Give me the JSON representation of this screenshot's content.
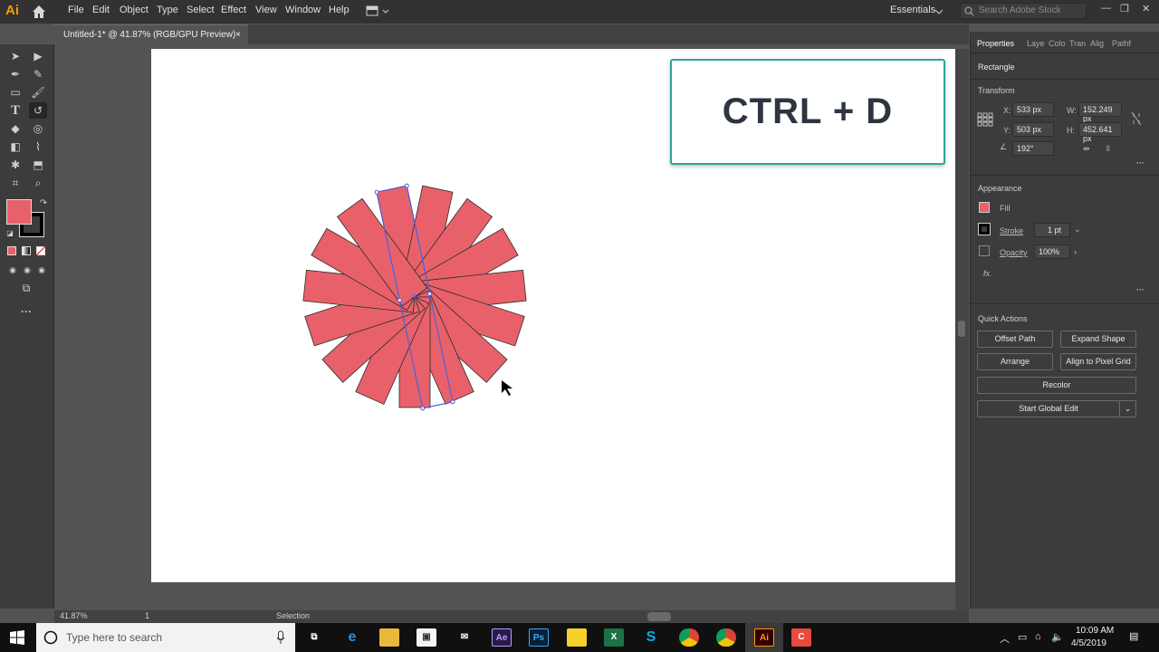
{
  "app": {
    "logo": "Ai",
    "workspace": "Essentials",
    "search_placeholder": "Search Adobe Stock"
  },
  "menu": [
    "File",
    "Edit",
    "Object",
    "Type",
    "Select",
    "Effect",
    "View",
    "Window",
    "Help"
  ],
  "document": {
    "tab_title": "Untitled-1* @ 41.87% (RGB/GPU Preview)",
    "close": "×"
  },
  "overlay": {
    "text": "CTRL + D"
  },
  "status": {
    "zoom": "41.87%",
    "page": "1",
    "tool": "Selection"
  },
  "properties": {
    "tabs": [
      "Properties",
      "Laye",
      "Colo",
      "Tran",
      "Alig",
      "Pathf"
    ],
    "object_type": "Rectangle",
    "transform": {
      "title": "Transform",
      "x_label": "X:",
      "x": "533 px",
      "y_label": "Y:",
      "y": "503 px",
      "w_label": "W:",
      "w": "152.249 px",
      "h_label": "H:",
      "h": "452.641 px",
      "angle": "192°"
    },
    "appearance": {
      "title": "Appearance",
      "fill_label": "Fill",
      "stroke_label": "Stroke",
      "stroke_value": "1 pt",
      "opacity_label": "Opacity",
      "opacity_value": "100%",
      "fx": "fx."
    },
    "quick_actions": {
      "title": "Quick Actions",
      "offset_path": "Offset Path",
      "expand_shape": "Expand Shape",
      "arrange": "Arrange",
      "align_pixel": "Align to Pixel Grid",
      "recolor": "Recolor",
      "global_edit": "Start Global Edit"
    }
  },
  "colors": {
    "fill": "#e8616a",
    "accent_overlay_border": "#2fa494",
    "selection": "#4a60e0"
  },
  "taskbar": {
    "search_placeholder": "Type here to search",
    "time": "10:09 AM",
    "date": "4/5/2019"
  }
}
